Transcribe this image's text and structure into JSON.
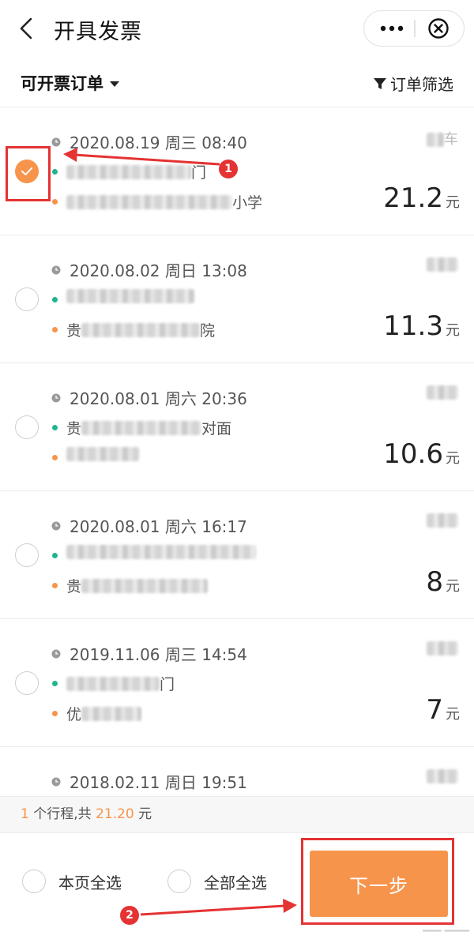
{
  "header": {
    "title": "开具发票",
    "back_icon": "chevron-left-icon",
    "more_icon": "more-dots-icon",
    "close_icon": "close-circle-icon"
  },
  "filter": {
    "left_label": "可开票订单",
    "right_label": "订单筛选"
  },
  "orders": [
    {
      "datetime": "2020.08.19 周三 08:40",
      "car_suffix": "车",
      "start_tail": "门",
      "end_tail": "小学",
      "amount": "21.2",
      "unit": "元",
      "checked": true
    },
    {
      "datetime": "2020.08.02 周日 13:08",
      "car_suffix": "",
      "start_tail": "",
      "end_head": "贵",
      "end_tail": "院",
      "amount": "11.3",
      "unit": "元",
      "checked": false
    },
    {
      "datetime": "2020.08.01 周六 20:36",
      "car_suffix": "",
      "start_head": "贵",
      "start_tail": "对面",
      "end_tail": "",
      "amount": "10.6",
      "unit": "元",
      "checked": false
    },
    {
      "datetime": "2020.08.01 周六 16:17",
      "car_suffix": "",
      "start_tail": "",
      "end_head": "贵",
      "end_tail": "",
      "amount": "8",
      "unit": "元",
      "checked": false
    },
    {
      "datetime": "2019.11.06 周三 14:54",
      "car_suffix": "",
      "start_tail": "门",
      "end_head": "优",
      "end_tail": "",
      "amount": "7",
      "unit": "元",
      "checked": false
    },
    {
      "datetime": "2018.02.11 周日 19:51",
      "car_suffix": "",
      "start_tail": "",
      "end_tail": "",
      "amount": "",
      "unit": "",
      "checked": false
    }
  ],
  "summary": {
    "count": "1",
    "text_mid": " 个行程,共 ",
    "total": "21.20",
    "text_end": " 元"
  },
  "footer": {
    "select_page": "本页全选",
    "select_all": "全部全选",
    "next": "下一步"
  },
  "annotations": {
    "badge1": "1",
    "badge2": "2"
  },
  "colors": {
    "accent": "#f7944c",
    "start_dot": "#21b48e",
    "annotation": "#e53232"
  }
}
